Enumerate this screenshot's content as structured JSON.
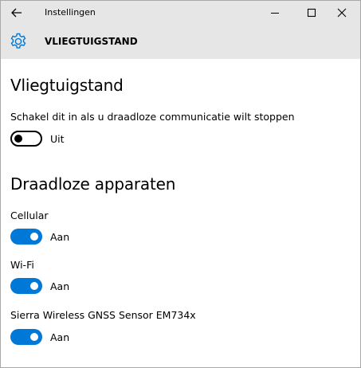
{
  "window": {
    "app_title": "Instellingen",
    "icons": {
      "back": "arrow-left-icon",
      "minimize": "minimize-icon",
      "maximize": "maximize-icon",
      "close": "close-icon"
    }
  },
  "header": {
    "title": "VLIEGTUIGSTAND",
    "icon": "gear-icon"
  },
  "airplane_mode": {
    "section_title": "Vliegtuigstand",
    "description": "Schakel dit in als u draadloze communicatie wilt stoppen",
    "toggle_on": false,
    "state_label": "Uit"
  },
  "wireless_devices": {
    "section_title": "Draadloze apparaten",
    "devices": [
      {
        "name": "Cellular",
        "toggle_on": true,
        "state_label": "Aan"
      },
      {
        "name": "Wi-Fi",
        "toggle_on": true,
        "state_label": "Aan"
      },
      {
        "name": "Sierra Wireless GNSS Sensor EM734x",
        "toggle_on": true,
        "state_label": "Aan"
      }
    ]
  },
  "colors": {
    "accent": "#0078d7",
    "titlebar": "#e6e6e6",
    "background": "#ffffff"
  }
}
